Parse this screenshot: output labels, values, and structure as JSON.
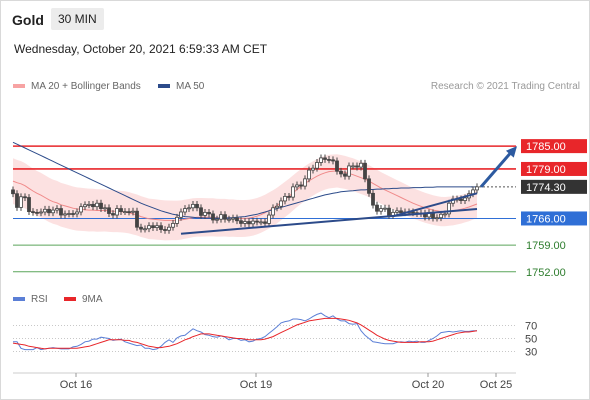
{
  "header": {
    "instrument": "Gold",
    "timeframe": "30 MIN",
    "datetime": "Wednesday, October 20, 2021 6:59:33 AM CET",
    "copyright": "Research © 2021 Trading Central"
  },
  "colors": {
    "resistance": "#e8262a",
    "support_main": "#2f6fd6",
    "support_minor": "#5aa55a",
    "price_tag": "#333333",
    "bollinger_fill": "#fcdcdc",
    "ma20": "#f08a8a",
    "ma50": "#2c4b8a",
    "candle": "#444444",
    "trendline": "#2c4b8a",
    "arrow": "#2c5aa0",
    "rsi": "#5b7fd6",
    "rsi_ma": "#e8262a"
  },
  "chart_data": [
    {
      "type": "candlestick",
      "title": "Gold 30 MIN",
      "legend": [
        "MA 20 + Bollinger Bands",
        "MA 50"
      ],
      "legend_position": "top-left",
      "x_ticks": [
        "Oct 16",
        "Oct 19",
        "Oct 20",
        "Oct 25"
      ],
      "ylim": [
        1748,
        1800
      ],
      "levels": [
        {
          "value": 1785.0,
          "label": "1785.00",
          "kind": "resistance"
        },
        {
          "value": 1779.0,
          "label": "1779.00",
          "kind": "resistance"
        },
        {
          "value": 1774.3,
          "label": "1774.30",
          "kind": "last-price"
        },
        {
          "value": 1766.0,
          "label": "1766.00",
          "kind": "support"
        },
        {
          "value": 1759.0,
          "label": "1759.00",
          "kind": "support-minor"
        },
        {
          "value": 1752.0,
          "label": "1752.00",
          "kind": "support-minor"
        }
      ],
      "close": [
        1772.5,
        1768.9,
        1771.7,
        1771.5,
        1767.8,
        1767.6,
        1767.5,
        1767.7,
        1768.4,
        1767.5,
        1768.2,
        1768.6,
        1766.9,
        1767.2,
        1767.3,
        1767.2,
        1767.7,
        1769.1,
        1769.6,
        1769.7,
        1769.1,
        1770.0,
        1768.6,
        1768.8,
        1767.3,
        1766.9,
        1768.6,
        1767.8,
        1767.8,
        1767.7,
        1767.9,
        1763.7,
        1763.2,
        1763.3,
        1764.1,
        1763.6,
        1764.1,
        1763.1,
        1762.9,
        1763.7,
        1764.7,
        1766.3,
        1767.7,
        1768.6,
        1768.8,
        1769.7,
        1768.8,
        1766.8,
        1767.6,
        1767.2,
        1765.6,
        1765.8,
        1767.0,
        1765.8,
        1765.8,
        1766.1,
        1765.4,
        1764.7,
        1765.2,
        1764.6,
        1765.3,
        1765.1,
        1765.1,
        1764.7,
        1766.9,
        1768.8,
        1769.2,
        1770.6,
        1771.8,
        1771.6,
        1774.3,
        1774.8,
        1774.5,
        1776.4,
        1778.7,
        1779.2,
        1780.7,
        1781.9,
        1781.5,
        1781.4,
        1781.1,
        1778.4,
        1777.7,
        1777.1,
        1779.8,
        1779.8,
        1779.5,
        1780.5,
        1776.4,
        1772.6,
        1769.5,
        1767.9,
        1768.6,
        1768.7,
        1766.8,
        1767.6,
        1768.0,
        1767.5,
        1767.7,
        1767.7,
        1767.5,
        1767.3,
        1767.4,
        1766.4,
        1767.5,
        1766.1,
        1766.2,
        1767.1,
        1767.2,
        1770.0,
        1771.1,
        1771.1,
        1770.7,
        1771.4,
        1772.5,
        1773.5,
        1774.3
      ],
      "ma20": [
        1775.8,
        1775.4,
        1775.1,
        1774.6,
        1773.9,
        1773.2,
        1772.6,
        1772.1,
        1771.5,
        1770.9,
        1770.4,
        1770.1,
        1769.6,
        1769.3,
        1769.0,
        1768.7,
        1768.5,
        1768.4,
        1768.3,
        1768.2,
        1768.2,
        1768.1,
        1768.1,
        1768.1,
        1768.0,
        1767.9,
        1767.9,
        1767.8,
        1767.7,
        1767.5,
        1767.2,
        1766.9,
        1766.5,
        1766.2,
        1765.9,
        1765.8,
        1765.7,
        1765.6,
        1765.5,
        1765.5,
        1765.5,
        1765.5,
        1765.6,
        1765.8,
        1766.0,
        1766.2,
        1766.3,
        1766.3,
        1766.3,
        1766.3,
        1766.3,
        1766.2,
        1766.2,
        1766.2,
        1766.1,
        1766.1,
        1766.0,
        1766.0,
        1766.0,
        1766.1,
        1766.3,
        1766.6,
        1767.0,
        1767.5,
        1768.1,
        1768.7,
        1769.4,
        1770.2,
        1771.0,
        1771.8,
        1772.7,
        1773.6,
        1774.4,
        1775.2,
        1775.9,
        1776.5,
        1777.1,
        1777.6,
        1778.0,
        1778.3,
        1778.4,
        1778.5,
        1778.3,
        1778.1,
        1777.8,
        1777.5,
        1777.1,
        1776.7,
        1776.3,
        1775.8,
        1775.2,
        1774.6,
        1774.0,
        1773.5,
        1773.0,
        1772.5,
        1772.0,
        1771.5,
        1771.0,
        1770.5,
        1770.0,
        1769.6,
        1769.2,
        1768.8,
        1768.5,
        1768.2,
        1768.0,
        1767.8,
        1767.8,
        1767.9,
        1768.0,
        1768.2,
        1768.4,
        1768.7,
        1769.0,
        1769.4,
        1769.8
      ],
      "ma50": [
        1786.0,
        1785.5,
        1785.0,
        1784.5,
        1784.0,
        1783.5,
        1783.0,
        1782.5,
        1782.0,
        1781.5,
        1781.0,
        1780.5,
        1780.0,
        1779.5,
        1779.0,
        1778.5,
        1778.0,
        1777.5,
        1777.0,
        1776.5,
        1776.0,
        1775.5,
        1775.0,
        1774.5,
        1774.0,
        1773.5,
        1773.0,
        1772.5,
        1772.0,
        1771.5,
        1771.0,
        1770.5,
        1770.0,
        1769.6,
        1769.2,
        1768.8,
        1768.4,
        1768.0,
        1767.7,
        1767.4,
        1767.1,
        1766.9,
        1766.7,
        1766.5,
        1766.4,
        1766.3,
        1766.2,
        1766.2,
        1766.1,
        1766.1,
        1766.1,
        1766.1,
        1766.1,
        1766.1,
        1766.2,
        1766.2,
        1766.3,
        1766.4,
        1766.5,
        1766.7,
        1766.9,
        1767.1,
        1767.4,
        1767.7,
        1768.0,
        1768.3,
        1768.6,
        1768.9,
        1769.2,
        1769.5,
        1769.8,
        1770.1,
        1770.4,
        1770.7,
        1771.0,
        1771.3,
        1771.6,
        1771.9,
        1772.2,
        1772.4,
        1772.6,
        1772.8,
        1773.0,
        1773.1,
        1773.2,
        1773.3,
        1773.4,
        1773.5,
        1773.5,
        1773.6,
        1773.6,
        1773.7,
        1773.7,
        1773.8,
        1773.8,
        1773.9,
        1773.9,
        1774.0,
        1774.0,
        1774.0,
        1774.1,
        1774.1,
        1774.1,
        1774.2,
        1774.2,
        1774.2,
        1774.3,
        1774.3,
        1774.3,
        1774.3,
        1774.3,
        1774.3,
        1774.3,
        1774.3,
        1774.3,
        1774.3,
        1774.3
      ],
      "trendlines": [
        {
          "from_bar": 42,
          "from_value": 1762.0,
          "to_bar": 116,
          "to_value": 1768.5
        },
        {
          "from_bar": 95,
          "from_value": 1766.6,
          "to_bar": 116,
          "to_value": 1772.6
        }
      ],
      "projection_arrow": {
        "from_bar": 117,
        "from_value": 1774.3,
        "to_bar": 126,
        "to_value": 1785.0
      }
    },
    {
      "type": "line",
      "title": "RSI",
      "legend": [
        "RSI",
        "9MA"
      ],
      "legend_position": "top-left",
      "y_ticks": [
        70,
        50,
        30
      ],
      "ylim": [
        0,
        100
      ],
      "rsi": [
        45,
        45,
        35,
        33,
        33,
        33,
        36,
        33,
        34,
        35,
        36,
        35,
        34,
        34,
        34,
        37,
        38,
        41,
        45,
        46,
        49,
        49,
        52,
        51,
        50,
        47,
        48,
        49,
        45,
        43,
        41,
        39,
        40,
        35,
        35,
        33,
        34,
        38,
        44,
        48,
        44,
        51,
        54,
        55,
        60,
        65,
        62,
        60,
        56,
        55,
        53,
        52,
        54,
        52,
        48,
        50,
        50,
        47,
        48,
        45,
        46,
        49,
        50,
        53,
        58,
        63,
        68,
        74,
        76,
        77,
        80,
        80,
        79,
        77,
        80,
        84,
        87,
        89,
        85,
        82,
        85,
        80,
        77,
        77,
        73,
        72,
        73,
        62,
        55,
        50,
        45,
        44,
        43,
        42,
        42,
        42,
        44,
        45,
        44,
        46,
        45,
        46,
        44,
        44,
        47,
        50,
        54,
        59,
        60,
        61,
        60,
        61,
        62,
        61,
        61,
        62,
        62
      ],
      "rsi_ma": [
        43,
        42,
        41,
        40,
        38,
        37,
        36,
        35,
        34,
        35,
        35,
        35,
        35,
        35,
        35,
        35,
        35,
        36,
        37,
        38,
        40,
        42,
        44,
        46,
        48,
        48,
        48,
        48,
        47,
        47,
        45,
        44,
        42,
        40,
        38,
        37,
        36,
        36,
        37,
        38,
        40,
        42,
        45,
        48,
        50,
        53,
        55,
        57,
        57,
        57,
        56,
        55,
        54,
        53,
        52,
        51,
        50,
        50,
        49,
        48,
        48,
        48,
        48,
        49,
        51,
        53,
        56,
        59,
        62,
        65,
        68,
        71,
        73,
        75,
        77,
        78,
        79,
        80,
        81,
        81,
        81,
        81,
        80,
        79,
        78,
        76,
        74,
        71,
        67,
        63,
        59,
        55,
        52,
        49,
        47,
        46,
        45,
        44,
        44,
        44,
        44,
        44,
        45,
        45,
        45,
        46,
        48,
        50,
        52,
        54,
        56,
        58,
        59,
        60,
        60,
        61,
        62
      ],
      "x_ticks": [
        "Oct 16",
        "Oct 19",
        "Oct 20",
        "Oct 25"
      ]
    }
  ]
}
